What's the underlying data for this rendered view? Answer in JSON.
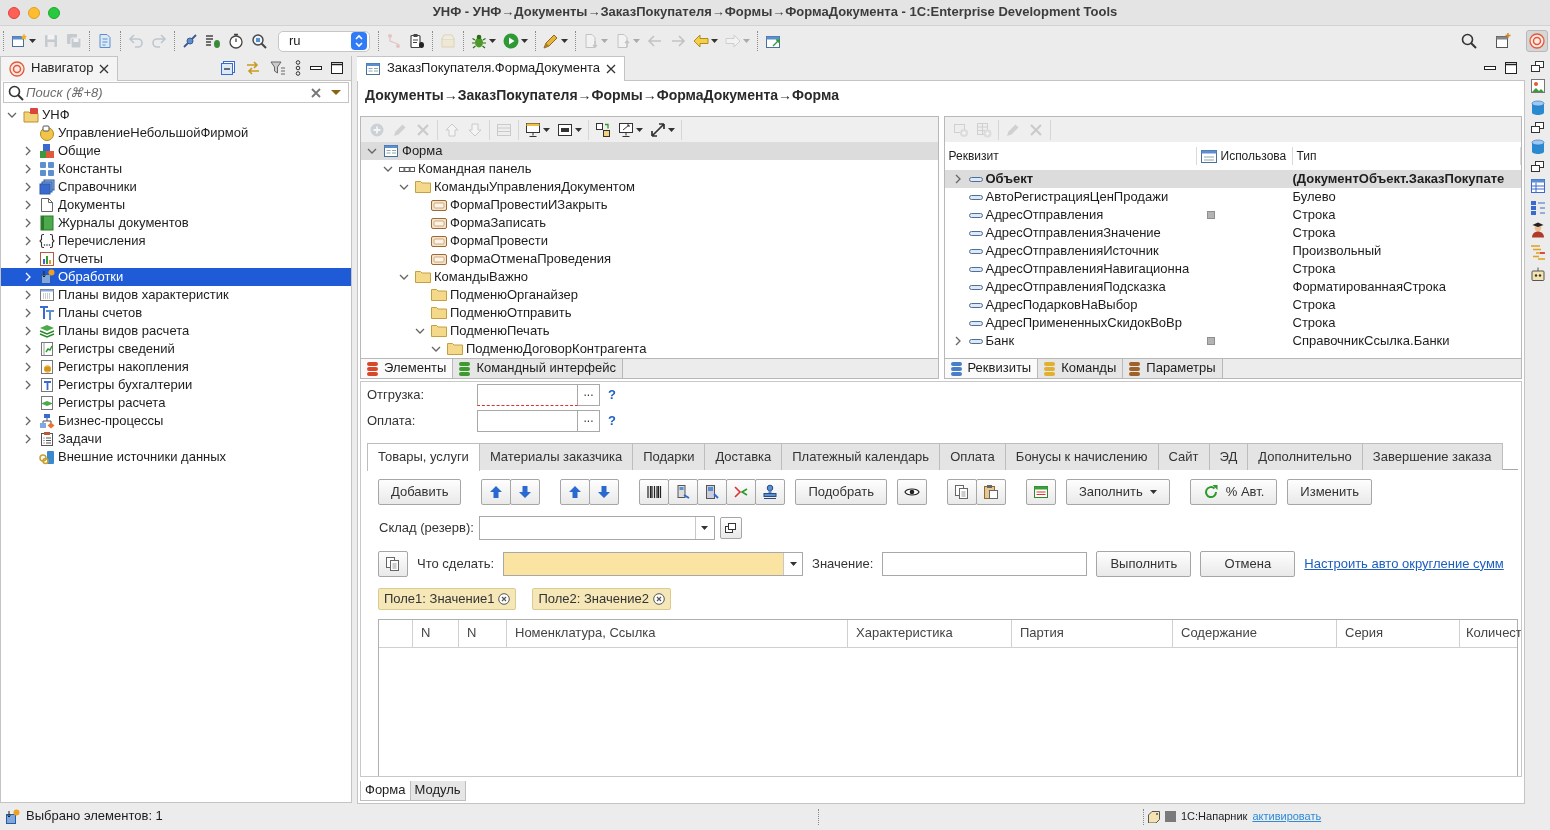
{
  "window": {
    "title": "УНФ - УНФ→Документы→ЗаказПокупателя→Формы→ФормаДокумента - 1C:Enterprise Development Tools"
  },
  "toolbar": {
    "left_groups": [
      [
        {
          "kind": "new",
          "disabled": false,
          "dropdown": true
        },
        {
          "kind": "save",
          "disabled": true,
          "dropdown": false
        },
        {
          "kind": "save-all",
          "disabled": true,
          "dropdown": false
        }
      ],
      [
        {
          "kind": "import",
          "disabled": false,
          "dropdown": false
        }
      ],
      [
        {
          "kind": "undo",
          "disabled": true,
          "dropdown": false
        },
        {
          "kind": "redo",
          "disabled": true,
          "dropdown": false
        }
      ],
      [
        {
          "kind": "connect",
          "disabled": false,
          "dropdown": false
        },
        {
          "kind": "debug-list",
          "disabled": false,
          "dropdown": false
        },
        {
          "kind": "timer",
          "disabled": false,
          "dropdown": false
        },
        {
          "kind": "search-db",
          "disabled": false,
          "dropdown": false
        }
      ]
    ],
    "language": "ru",
    "right_groups": [
      [
        {
          "kind": "branch",
          "disabled": true,
          "dropdown": false
        },
        {
          "kind": "clipboard-bug",
          "disabled": false,
          "dropdown": false
        }
      ],
      [
        {
          "kind": "package",
          "disabled": true,
          "dropdown": false
        }
      ],
      [
        {
          "kind": "bug",
          "disabled": false,
          "dropdown": true
        },
        {
          "kind": "run",
          "disabled": false,
          "dropdown": true
        }
      ],
      [
        {
          "kind": "pen",
          "disabled": false,
          "dropdown": true
        }
      ],
      [
        {
          "kind": "doc-down",
          "disabled": true,
          "dropdown": true
        },
        {
          "kind": "doc-up",
          "disabled": true,
          "dropdown": true
        },
        {
          "kind": "prev-edit",
          "disabled": true,
          "dropdown": false
        },
        {
          "kind": "next-edit",
          "disabled": true,
          "dropdown": false
        },
        {
          "kind": "back",
          "disabled": false,
          "dropdown": true
        },
        {
          "kind": "forward",
          "disabled": true,
          "dropdown": true
        }
      ],
      [
        {
          "kind": "open-form",
          "disabled": false,
          "dropdown": false
        }
      ]
    ],
    "end_buttons": [
      {
        "kind": "search",
        "selected": false
      },
      {
        "kind": "perspective",
        "selected": false
      },
      {
        "kind": "enterprise",
        "selected": true
      }
    ]
  },
  "navigator": {
    "tab": "Навигатор",
    "search": {
      "placeholder": "Поиск (⌘+8)"
    },
    "tree": [
      {
        "label": "УНФ",
        "kind": "project",
        "expandable": true,
        "expanded": true,
        "selected": false,
        "children": [
          {
            "label": "УправлениеНебольшойФирмой",
            "kind": "configuration",
            "expandable": false,
            "selected": false
          },
          {
            "label": "Общие",
            "kind": "common",
            "expandable": true,
            "expanded": false,
            "selected": false
          },
          {
            "label": "Константы",
            "kind": "constants",
            "expandable": true,
            "expanded": false,
            "selected": false
          },
          {
            "label": "Справочники",
            "kind": "catalogs",
            "expandable": true,
            "expanded": false,
            "selected": false
          },
          {
            "label": "Документы",
            "kind": "documents",
            "expandable": true,
            "expanded": false,
            "selected": false
          },
          {
            "label": "Журналы документов",
            "kind": "journals",
            "expandable": true,
            "expanded": false,
            "selected": false
          },
          {
            "label": "Перечисления",
            "kind": "enums",
            "expandable": true,
            "expanded": false,
            "selected": false
          },
          {
            "label": "Отчеты",
            "kind": "reports",
            "expandable": true,
            "expanded": false,
            "selected": false
          },
          {
            "label": "Обработки",
            "kind": "processors",
            "expandable": true,
            "expanded": false,
            "selected": true
          },
          {
            "label": "Планы видов характеристик",
            "kind": "characteristics",
            "expandable": true,
            "expanded": false,
            "selected": false
          },
          {
            "label": "Планы счетов",
            "kind": "accounts",
            "expandable": true,
            "expanded": false,
            "selected": false
          },
          {
            "label": "Планы видов расчета",
            "kind": "calculation-types",
            "expandable": true,
            "expanded": false,
            "selected": false
          },
          {
            "label": "Регистры сведений",
            "kind": "info-registers",
            "expandable": true,
            "expanded": false,
            "selected": false
          },
          {
            "label": "Регистры накопления",
            "kind": "accumulation-registers",
            "expandable": true,
            "expanded": false,
            "selected": false
          },
          {
            "label": "Регистры бухгалтерии",
            "kind": "accounting-registers",
            "expandable": true,
            "expanded": false,
            "selected": false
          },
          {
            "label": "Регистры расчета",
            "kind": "calculation-registers",
            "expandable": false,
            "selected": false
          },
          {
            "label": "Бизнес-процессы",
            "kind": "business-processes",
            "expandable": true,
            "expanded": false,
            "selected": false
          },
          {
            "label": "Задачи",
            "kind": "tasks",
            "expandable": true,
            "expanded": false,
            "selected": false
          },
          {
            "label": "Внешние источники данных",
            "kind": "external-sources",
            "expandable": false,
            "selected": false
          }
        ]
      }
    ]
  },
  "editor": {
    "tab": "ЗаказПокупателя.ФормаДокумента",
    "breadcrumb": "Документы→ЗаказПокупателя→Формы→ФормаДокумента→Форма",
    "elements_pane": {
      "toolbar": [
        [
          {
            "kind": "add",
            "disabled": true,
            "dropdown": false
          },
          {
            "kind": "edit",
            "disabled": true,
            "dropdown": false
          },
          {
            "kind": "delete",
            "disabled": true,
            "dropdown": false
          }
        ],
        [
          {
            "kind": "up",
            "disabled": true,
            "dropdown": false
          },
          {
            "kind": "down",
            "disabled": true,
            "dropdown": false
          }
        ],
        [
          {
            "kind": "cmd-panel",
            "disabled": true,
            "dropdown": false
          }
        ],
        [
          {
            "kind": "display",
            "disabled": false,
            "dropdown": true
          },
          {
            "kind": "layout",
            "disabled": false,
            "dropdown": true
          }
        ],
        [
          {
            "kind": "swap",
            "disabled": false,
            "dropdown": false
          },
          {
            "kind": "size",
            "disabled": false,
            "dropdown": true
          },
          {
            "kind": "resize",
            "disabled": false,
            "dropdown": true
          }
        ]
      ],
      "tree": [
        {
          "label": "Форма",
          "kind": "form",
          "expandable": true,
          "expanded": true,
          "selected": true,
          "children": [
            {
              "label": "Командная панель",
              "kind": "command-bar",
              "expandable": true,
              "expanded": true,
              "selected": false,
              "children": [
                {
                  "label": "КомандыУправленияДокументом",
                  "kind": "folder",
                  "expandable": true,
                  "expanded": true,
                  "selected": false,
                  "children": [
                    {
                      "label": "ФормаПровестиИЗакрыть",
                      "kind": "command",
                      "expandable": false,
                      "selected": false
                    },
                    {
                      "label": "ФормаЗаписать",
                      "kind": "command",
                      "expandable": false,
                      "selected": false
                    },
                    {
                      "label": "ФормаПровести",
                      "kind": "command",
                      "expandable": false,
                      "selected": false
                    },
                    {
                      "label": "ФормаОтменаПроведения",
                      "kind": "command",
                      "expandable": false,
                      "selected": false
                    }
                  ]
                },
                {
                  "label": "КомандыВажно",
                  "kind": "folder",
                  "expandable": true,
                  "expanded": true,
                  "selected": false,
                  "children": [
                    {
                      "label": "ПодменюОрганайзер",
                      "kind": "folder",
                      "expandable": false,
                      "selected": false
                    },
                    {
                      "label": "ПодменюОтправить",
                      "kind": "folder",
                      "expandable": false,
                      "selected": false
                    },
                    {
                      "label": "ПодменюПечать",
                      "kind": "folder",
                      "expandable": true,
                      "expanded": true,
                      "selected": false,
                      "children": [
                        {
                          "label": "ПодменюДоговорКонтрагента",
                          "kind": "folder",
                          "expandable": true,
                          "expanded": true,
                          "selected": false
                        }
                      ]
                    }
                  ]
                }
              ]
            }
          ]
        }
      ],
      "tabs": [
        {
          "label": "Элементы",
          "selected": true,
          "color": "#d9472b"
        },
        {
          "label": "Командный интерфейс",
          "selected": false,
          "color": "#3c9a2e"
        }
      ]
    },
    "attributes_pane": {
      "toolbar": [
        [
          {
            "kind": "add-attr",
            "disabled": true,
            "dropdown": false
          },
          {
            "kind": "add-table",
            "disabled": true,
            "dropdown": false
          }
        ],
        [
          {
            "kind": "edit",
            "disabled": true,
            "dropdown": false
          },
          {
            "kind": "delete",
            "disabled": true,
            "dropdown": false
          }
        ]
      ],
      "columns": {
        "name": "Реквизит",
        "use": "Использова",
        "type": "Тип"
      },
      "rows": [
        {
          "name": "Объект",
          "type": "(ДокументОбъект.ЗаказПокупате",
          "expandable": true,
          "expanded": false,
          "selected": true,
          "main": true,
          "marker": false
        },
        {
          "name": "АвтоРегистрацияЦенПродажи",
          "type": "Булево",
          "expandable": false,
          "selected": false,
          "main": false,
          "marker": false
        },
        {
          "name": "АдресОтправления",
          "type": "Строка",
          "expandable": false,
          "selected": false,
          "main": false,
          "marker": true
        },
        {
          "name": "АдресОтправленияЗначение",
          "type": "Строка",
          "expandable": false,
          "selected": false,
          "main": false,
          "marker": false
        },
        {
          "name": "АдресОтправленияИсточник",
          "type": "Произвольный",
          "expandable": false,
          "selected": false,
          "main": false,
          "marker": false
        },
        {
          "name": "АдресОтправленияНавигационна",
          "type": "Строка",
          "expandable": false,
          "selected": false,
          "main": false,
          "marker": false
        },
        {
          "name": "АдресОтправленияПодсказка",
          "type": "ФорматированнаяСтрока",
          "expandable": false,
          "selected": false,
          "main": false,
          "marker": false
        },
        {
          "name": "АдресПодарковНаВыбор",
          "type": "Строка",
          "expandable": false,
          "selected": false,
          "main": false,
          "marker": false
        },
        {
          "name": "АдресПримененныхСкидокВоВр",
          "type": "Строка",
          "expandable": false,
          "selected": false,
          "main": false,
          "marker": false
        },
        {
          "name": "Банк",
          "type": "СправочникСсылка.Банки",
          "expandable": true,
          "expanded": false,
          "selected": false,
          "main": false,
          "marker": true
        }
      ],
      "tabs": [
        {
          "label": "Реквизиты",
          "selected": true,
          "color": "#4a7fc8"
        },
        {
          "label": "Команды",
          "selected": false,
          "color": "#e0b030"
        },
        {
          "label": "Параметры",
          "selected": false,
          "color": "#a0602a"
        }
      ]
    },
    "form_preview": {
      "fields": [
        {
          "label": "Отгрузка:",
          "select_button": "...",
          "help": "?",
          "required": true
        },
        {
          "label": "Оплата:",
          "select_button": "...",
          "help": "?",
          "required": false
        }
      ],
      "tabs": [
        {
          "label": "Товары, услуги",
          "selected": true
        },
        {
          "label": "Материалы заказчика",
          "selected": false
        },
        {
          "label": "Подарки",
          "selected": false
        },
        {
          "label": "Доставка",
          "selected": false
        },
        {
          "label": "Платежный календарь",
          "selected": false
        },
        {
          "label": "Оплата",
          "selected": false
        },
        {
          "label": "Бонусы к начислению",
          "selected": false
        },
        {
          "label": "Сайт",
          "selected": false
        },
        {
          "label": "ЭД",
          "selected": false
        },
        {
          "label": "Дополнительно",
          "selected": false
        },
        {
          "label": "Завершение заказа",
          "selected": false
        }
      ],
      "command_bar": [
        {
          "kind": "text-button",
          "label": "Добавить"
        },
        {
          "kind": "move-buttons"
        },
        {
          "kind": "move-buttons"
        },
        {
          "kind": "tool-buttons"
        },
        {
          "kind": "text-button",
          "label": "Подобрать"
        },
        {
          "kind": "eye-button"
        },
        {
          "kind": "copy-paste-buttons"
        },
        {
          "kind": "table-button"
        },
        {
          "kind": "menu-button",
          "label": "Заполнить"
        },
        {
          "kind": "refresh-button",
          "label": "% Авт."
        },
        {
          "kind": "text-button",
          "label": "Изменить"
        }
      ],
      "warehouse": {
        "label": "Склад (резерв):"
      },
      "action": {
        "label": "Что сделать:",
        "highlighted": true,
        "value_label": "Значение:",
        "buttons": [
          "Выполнить",
          "Отмена"
        ],
        "link": "Настроить авто округление сумм"
      },
      "filters": [
        "Поле1: Значение1",
        "Поле2: Значение2"
      ],
      "table": {
        "columns": [
          "N",
          "N",
          "Номенклатура, Ссылка",
          "Характеристика",
          "Партия",
          "Содержание",
          "Серия",
          "Количест"
        ]
      }
    },
    "bottom_tabs": [
      {
        "label": "Форма",
        "selected": true
      },
      {
        "label": "Модуль",
        "selected": false
      }
    ]
  },
  "side_strip": [
    {
      "kind": "restore"
    },
    {
      "kind": "image"
    },
    {
      "kind": "database"
    },
    {
      "kind": "restore"
    },
    {
      "kind": "database"
    },
    {
      "kind": "restore"
    },
    {
      "kind": "table"
    },
    {
      "kind": "tree"
    },
    {
      "kind": "person"
    },
    {
      "kind": "bars"
    },
    {
      "kind": "robot"
    }
  ],
  "status_bar": {
    "text": "Выбрано элементов: 1",
    "assistant": "1C:Напарник",
    "link": "активировать"
  }
}
